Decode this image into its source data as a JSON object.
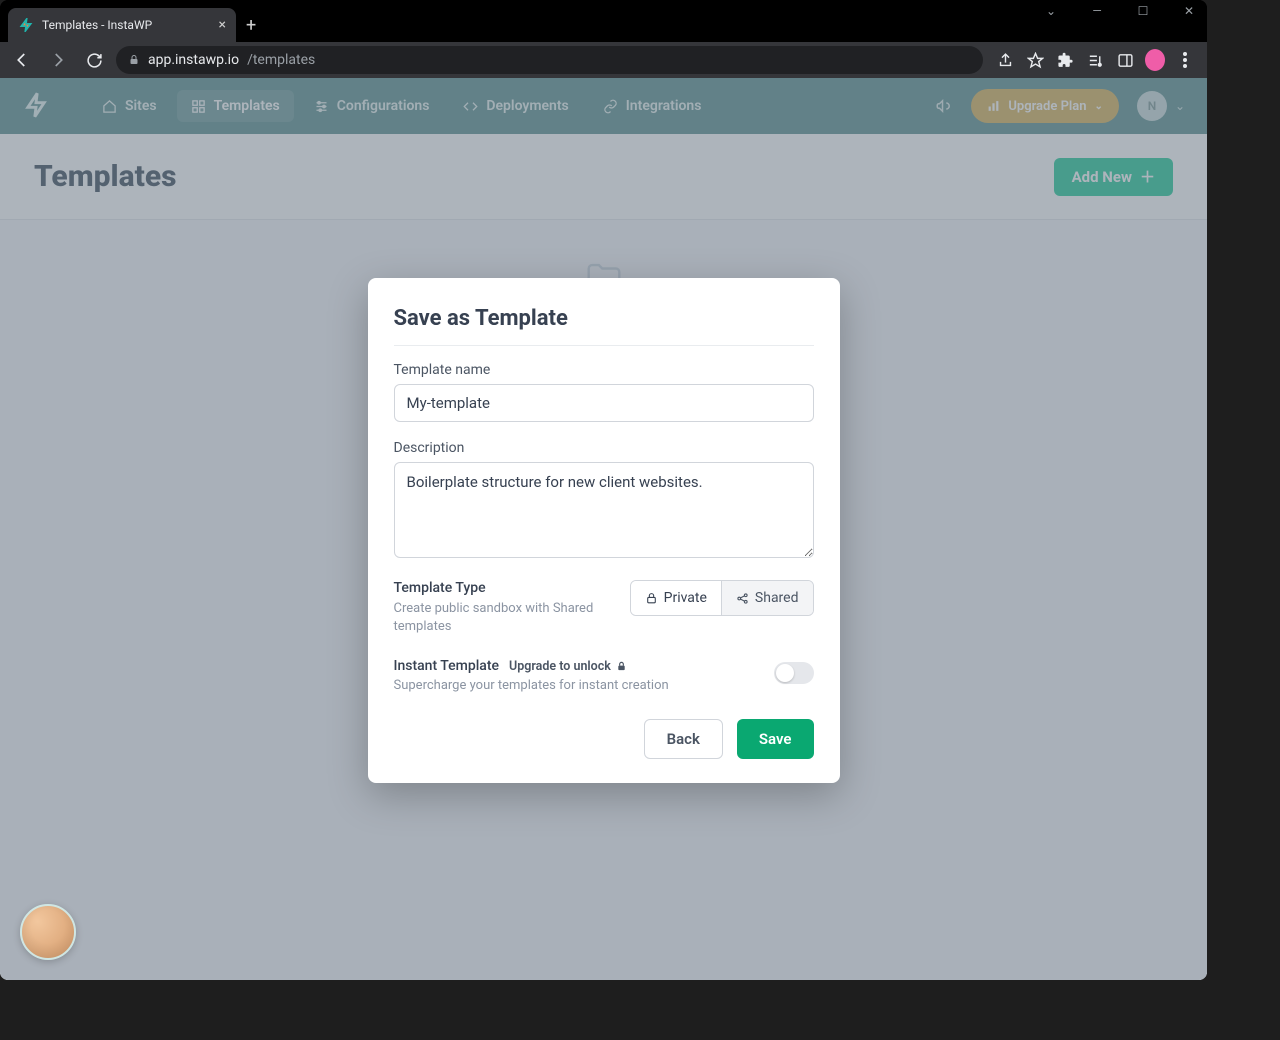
{
  "browser": {
    "tab_title": "Templates - InstaWP",
    "url_domain": "app.instawp.io",
    "url_path": "/templates"
  },
  "nav": {
    "items": [
      {
        "label": "Sites"
      },
      {
        "label": "Templates"
      },
      {
        "label": "Configurations"
      },
      {
        "label": "Deployments"
      },
      {
        "label": "Integrations"
      }
    ],
    "upgrade_label": "Upgrade Plan",
    "user_initial": "N"
  },
  "page": {
    "title": "Templates",
    "add_new_label": "Add New"
  },
  "modal": {
    "title": "Save as Template",
    "name_label": "Template name",
    "name_value": "My-template",
    "desc_label": "Description",
    "desc_value": "Boilerplate structure for new client websites.",
    "type_label": "Template Type",
    "type_desc": "Create public sandbox with Shared templates",
    "type_private": "Private",
    "type_shared": "Shared",
    "instant_label": "Instant Template",
    "instant_upgrade": "Upgrade to unlock",
    "instant_desc": "Supercharge your templates for instant creation",
    "back_label": "Back",
    "save_label": "Save"
  }
}
